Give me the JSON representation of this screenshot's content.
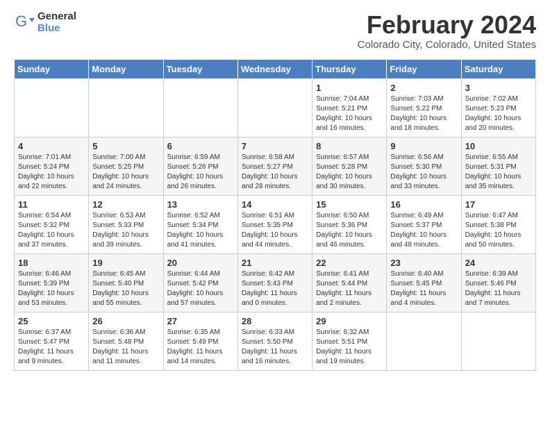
{
  "logo": {
    "general": "General",
    "blue": "Blue"
  },
  "title": "February 2024",
  "location": "Colorado City, Colorado, United States",
  "headers": [
    "Sunday",
    "Monday",
    "Tuesday",
    "Wednesday",
    "Thursday",
    "Friday",
    "Saturday"
  ],
  "weeks": [
    [
      {
        "day": "",
        "sunrise": "",
        "sunset": "",
        "daylight": ""
      },
      {
        "day": "",
        "sunrise": "",
        "sunset": "",
        "daylight": ""
      },
      {
        "day": "",
        "sunrise": "",
        "sunset": "",
        "daylight": ""
      },
      {
        "day": "",
        "sunrise": "",
        "sunset": "",
        "daylight": ""
      },
      {
        "day": "1",
        "sunrise": "Sunrise: 7:04 AM",
        "sunset": "Sunset: 5:21 PM",
        "daylight": "Daylight: 10 hours and 16 minutes."
      },
      {
        "day": "2",
        "sunrise": "Sunrise: 7:03 AM",
        "sunset": "Sunset: 5:22 PM",
        "daylight": "Daylight: 10 hours and 18 minutes."
      },
      {
        "day": "3",
        "sunrise": "Sunrise: 7:02 AM",
        "sunset": "Sunset: 5:23 PM",
        "daylight": "Daylight: 10 hours and 20 minutes."
      }
    ],
    [
      {
        "day": "4",
        "sunrise": "Sunrise: 7:01 AM",
        "sunset": "Sunset: 5:24 PM",
        "daylight": "Daylight: 10 hours and 22 minutes."
      },
      {
        "day": "5",
        "sunrise": "Sunrise: 7:00 AM",
        "sunset": "Sunset: 5:25 PM",
        "daylight": "Daylight: 10 hours and 24 minutes."
      },
      {
        "day": "6",
        "sunrise": "Sunrise: 6:59 AM",
        "sunset": "Sunset: 5:26 PM",
        "daylight": "Daylight: 10 hours and 26 minutes."
      },
      {
        "day": "7",
        "sunrise": "Sunrise: 6:58 AM",
        "sunset": "Sunset: 5:27 PM",
        "daylight": "Daylight: 10 hours and 28 minutes."
      },
      {
        "day": "8",
        "sunrise": "Sunrise: 6:57 AM",
        "sunset": "Sunset: 5:28 PM",
        "daylight": "Daylight: 10 hours and 30 minutes."
      },
      {
        "day": "9",
        "sunrise": "Sunrise: 6:56 AM",
        "sunset": "Sunset: 5:30 PM",
        "daylight": "Daylight: 10 hours and 33 minutes."
      },
      {
        "day": "10",
        "sunrise": "Sunrise: 6:55 AM",
        "sunset": "Sunset: 5:31 PM",
        "daylight": "Daylight: 10 hours and 35 minutes."
      }
    ],
    [
      {
        "day": "11",
        "sunrise": "Sunrise: 6:54 AM",
        "sunset": "Sunset: 5:32 PM",
        "daylight": "Daylight: 10 hours and 37 minutes."
      },
      {
        "day": "12",
        "sunrise": "Sunrise: 6:53 AM",
        "sunset": "Sunset: 5:33 PM",
        "daylight": "Daylight: 10 hours and 39 minutes."
      },
      {
        "day": "13",
        "sunrise": "Sunrise: 6:52 AM",
        "sunset": "Sunset: 5:34 PM",
        "daylight": "Daylight: 10 hours and 41 minutes."
      },
      {
        "day": "14",
        "sunrise": "Sunrise: 6:51 AM",
        "sunset": "Sunset: 5:35 PM",
        "daylight": "Daylight: 10 hours and 44 minutes."
      },
      {
        "day": "15",
        "sunrise": "Sunrise: 6:50 AM",
        "sunset": "Sunset: 5:36 PM",
        "daylight": "Daylight: 10 hours and 46 minutes."
      },
      {
        "day": "16",
        "sunrise": "Sunrise: 6:49 AM",
        "sunset": "Sunset: 5:37 PM",
        "daylight": "Daylight: 10 hours and 48 minutes."
      },
      {
        "day": "17",
        "sunrise": "Sunrise: 6:47 AM",
        "sunset": "Sunset: 5:38 PM",
        "daylight": "Daylight: 10 hours and 50 minutes."
      }
    ],
    [
      {
        "day": "18",
        "sunrise": "Sunrise: 6:46 AM",
        "sunset": "Sunset: 5:39 PM",
        "daylight": "Daylight: 10 hours and 53 minutes."
      },
      {
        "day": "19",
        "sunrise": "Sunrise: 6:45 AM",
        "sunset": "Sunset: 5:40 PM",
        "daylight": "Daylight: 10 hours and 55 minutes."
      },
      {
        "day": "20",
        "sunrise": "Sunrise: 6:44 AM",
        "sunset": "Sunset: 5:42 PM",
        "daylight": "Daylight: 10 hours and 57 minutes."
      },
      {
        "day": "21",
        "sunrise": "Sunrise: 6:42 AM",
        "sunset": "Sunset: 5:43 PM",
        "daylight": "Daylight: 11 hours and 0 minutes."
      },
      {
        "day": "22",
        "sunrise": "Sunrise: 6:41 AM",
        "sunset": "Sunset: 5:44 PM",
        "daylight": "Daylight: 11 hours and 2 minutes."
      },
      {
        "day": "23",
        "sunrise": "Sunrise: 6:40 AM",
        "sunset": "Sunset: 5:45 PM",
        "daylight": "Daylight: 11 hours and 4 minutes."
      },
      {
        "day": "24",
        "sunrise": "Sunrise: 6:39 AM",
        "sunset": "Sunset: 5:46 PM",
        "daylight": "Daylight: 11 hours and 7 minutes."
      }
    ],
    [
      {
        "day": "25",
        "sunrise": "Sunrise: 6:37 AM",
        "sunset": "Sunset: 5:47 PM",
        "daylight": "Daylight: 11 hours and 9 minutes."
      },
      {
        "day": "26",
        "sunrise": "Sunrise: 6:36 AM",
        "sunset": "Sunset: 5:48 PM",
        "daylight": "Daylight: 11 hours and 11 minutes."
      },
      {
        "day": "27",
        "sunrise": "Sunrise: 6:35 AM",
        "sunset": "Sunset: 5:49 PM",
        "daylight": "Daylight: 11 hours and 14 minutes."
      },
      {
        "day": "28",
        "sunrise": "Sunrise: 6:33 AM",
        "sunset": "Sunset: 5:50 PM",
        "daylight": "Daylight: 11 hours and 16 minutes."
      },
      {
        "day": "29",
        "sunrise": "Sunrise: 6:32 AM",
        "sunset": "Sunset: 5:51 PM",
        "daylight": "Daylight: 11 hours and 19 minutes."
      },
      {
        "day": "",
        "sunrise": "",
        "sunset": "",
        "daylight": ""
      },
      {
        "day": "",
        "sunrise": "",
        "sunset": "",
        "daylight": ""
      }
    ]
  ]
}
